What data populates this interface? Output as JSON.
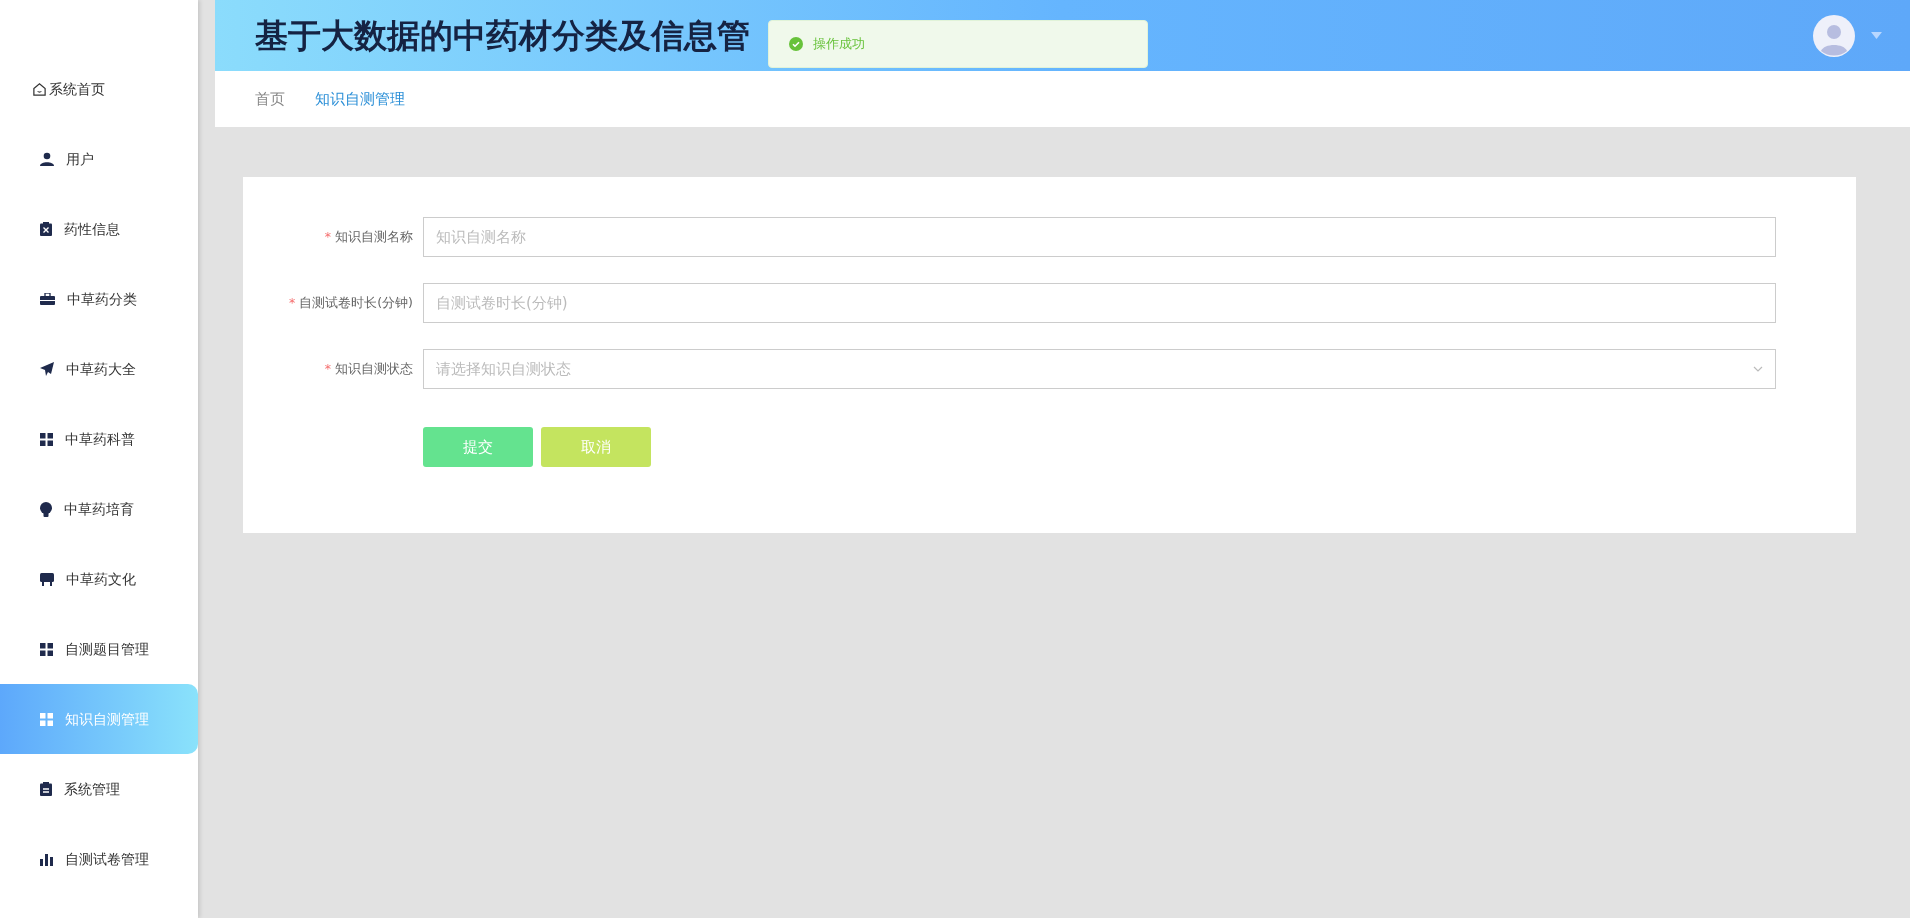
{
  "sidebar": {
    "items": [
      {
        "label": "系统首页",
        "selected": false
      },
      {
        "label": "用户",
        "selected": false
      },
      {
        "label": "药性信息",
        "selected": false
      },
      {
        "label": "中草药分类",
        "selected": false
      },
      {
        "label": "中草药大全",
        "selected": false
      },
      {
        "label": "中草药科普",
        "selected": false
      },
      {
        "label": "中草药培育",
        "selected": false
      },
      {
        "label": "中草药文化",
        "selected": false
      },
      {
        "label": "自测题目管理",
        "selected": false
      },
      {
        "label": "知识自测管理",
        "selected": true
      },
      {
        "label": "系统管理",
        "selected": false
      },
      {
        "label": "自测试卷管理",
        "selected": false
      }
    ]
  },
  "header": {
    "title": "基于大数据的中药材分类及信息管"
  },
  "toast": {
    "message": "操作成功"
  },
  "breadcrumb": [
    {
      "label": "首页",
      "selected": false
    },
    {
      "label": "知识自测管理",
      "selected": true
    }
  ],
  "form": {
    "fields": [
      {
        "kind": "input",
        "required_mark": "*",
        "label": "知识自测名称",
        "placeholder": "知识自测名称"
      },
      {
        "kind": "input",
        "required_mark": "*",
        "label": "自测试卷时长(分钟)",
        "placeholder": "自测试卷时长(分钟)"
      },
      {
        "kind": "select",
        "required_mark": "*",
        "label": "知识自测状态",
        "placeholder": "请选择知识自测状态"
      }
    ],
    "buttons": [
      {
        "label": "提交",
        "kind": "submit"
      },
      {
        "label": "取消",
        "kind": "cancel"
      }
    ]
  }
}
